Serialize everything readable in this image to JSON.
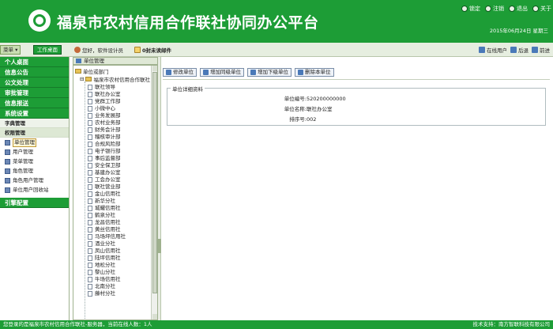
{
  "header": {
    "title": "福泉市农村信用合作联社协同办公平台",
    "links": [
      "锁定",
      "注销",
      "退出",
      "关于"
    ],
    "date": "2015年06月24日 星期三"
  },
  "toolbar": {
    "menu_label": "菜单",
    "desk_label": "工作桌面",
    "user_text": "您好，软件设计员",
    "mail_text": "0封未读邮件",
    "right_links": [
      "在线用户",
      "后退",
      "前进"
    ]
  },
  "sidebar": {
    "sections": [
      "个人桌面",
      "信息公告",
      "公文处理",
      "审批管理",
      "信息报送",
      "系统设置"
    ],
    "subs": [
      "字典管理",
      "权限管理"
    ],
    "items": [
      "单位管理",
      "用户管理",
      "菜单管理",
      "角色管理",
      "角色用户管理",
      "单位用户回收站"
    ],
    "bottom_section": "引擎配置"
  },
  "tree": {
    "header": "单位管理",
    "root": "单位或部门",
    "org": "福泉市农村信用合作联社",
    "nodes": [
      "联社领导",
      "联社办公室",
      "党群工作部",
      "小微中心",
      "业务发展部",
      "农村业务部",
      "财务会计部",
      "稽核审计部",
      "合规风险部",
      "电子银行部",
      "事后监督部",
      "安全保卫部",
      "基建办公室",
      "工会办公室",
      "联社营业部",
      "金山信用社",
      "新华分社",
      "城耀信用社",
      "鹤泉分社",
      "龙昌信用社",
      "黄丝信用社",
      "马场坪信用社",
      "酒业分社",
      "凤山信用社",
      "陆坪信用社",
      "地松分社",
      "黎山分社",
      "牛场信用社",
      "北南分社",
      "藤村分社"
    ]
  },
  "actions": [
    "修改单位",
    "增加同级单位",
    "增加下级单位",
    "删除本单位"
  ],
  "detail": {
    "legend": "单位详细资料",
    "rows": [
      {
        "key": "单位编号:",
        "value": "520200000000"
      },
      {
        "key": "单位名称:",
        "value": "联社办公室"
      },
      {
        "key": "排序号:",
        "value": "002"
      }
    ]
  },
  "status": {
    "left": "您登录的是福泉市农村信用合作联社-服务器，当前在线人数：1人",
    "right": "技术支持：南方智联科技有限公司"
  }
}
